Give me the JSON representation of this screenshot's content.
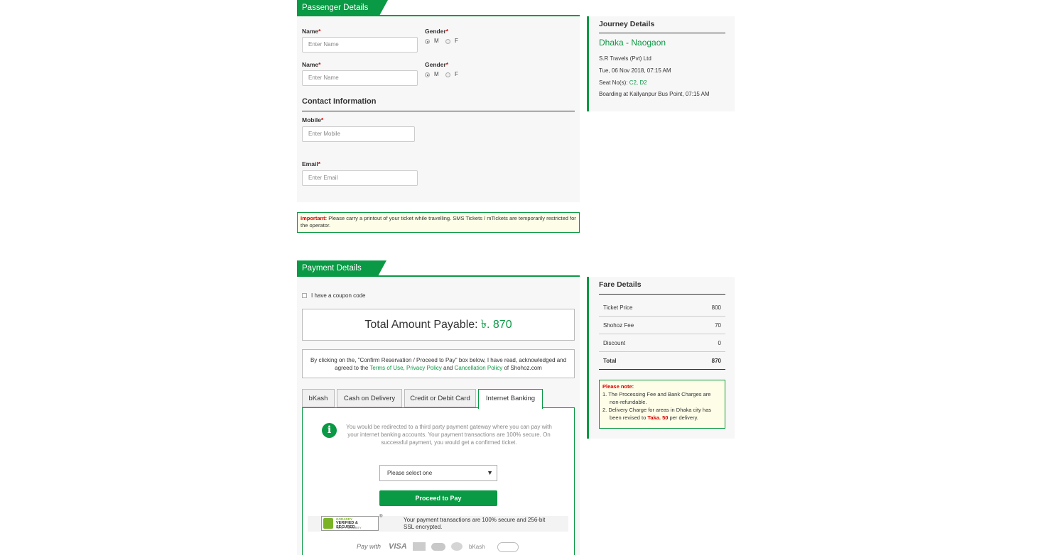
{
  "passenger": {
    "section_title": "Passenger Details",
    "rows": [
      {
        "name_label": "Name",
        "name_placeholder": "Enter Name",
        "gender_label": "Gender",
        "m": "M",
        "f": "F"
      },
      {
        "name_label": "Name",
        "name_placeholder": "Enter Name",
        "gender_label": "Gender",
        "m": "M",
        "f": "F"
      }
    ],
    "required_mark": "*"
  },
  "contact": {
    "title": "Contact Information",
    "mobile_label": "Mobile",
    "mobile_placeholder": "Enter Mobile",
    "email_label": "Email",
    "email_placeholder": "Enter Email"
  },
  "important": {
    "label": "Important:",
    "text": "Please carry a printout of your ticket while travelling. SMS Tickets / mTickets are temporarily restricted for the operator."
  },
  "journey": {
    "title": "Journey Details",
    "route": "Dhaka - Naogaon",
    "operator": "S.R Travels (Pvt) Ltd",
    "datetime": "Tue, 06 Nov 2018, 07:15 AM",
    "seat_label": "Seat No(s):",
    "seats": "C2, D2",
    "boarding": "Boarding at Kallyanpur Bus Point, 07:15 AM"
  },
  "payment": {
    "section_title": "Payment Details",
    "coupon_label": "I have a coupon code",
    "total_label": "Total Amount Payable:",
    "total_value": "৳. 870",
    "terms_line1": "By clicking on the, \"Confirm Reservation / Proceed to Pay\" box below, I have read, acknowledged and",
    "terms_pre": "agreed to the",
    "terms_link1": "Terms of Use",
    "terms_comma": ",",
    "terms_link2": "Privacy Policy",
    "terms_and": "and",
    "terms_link3": "Cancellation Policy",
    "terms_post": "of Shohoz.com",
    "tabs": [
      "bKash",
      "Cash on Delivery",
      "Credit or Debit Card",
      "Internet Banking"
    ],
    "info_text": "You would be redirected to a third party payment gateway where you can pay with your internet banking accounts. Your payment transactions are 100% secure. On successful payment, you would get a confirmed ticket.",
    "select_value": "Please select one",
    "proceed_label": "Proceed to Pay",
    "badge_line1": "GODADDY",
    "badge_line2": "VERIFIED & SECURED",
    "badge_line3": "VERIFY SECURITY",
    "secure_text": "Your payment transactions are 100% secure and 256-bit SSL encrypted.",
    "paywith": "Pay with",
    "logos": [
      "VISA",
      "bKash"
    ]
  },
  "fare": {
    "title": "Fare Details",
    "rows": [
      {
        "label": "Ticket Price",
        "value": "800"
      },
      {
        "label": "Shohoz Fee",
        "value": "70"
      },
      {
        "label": "Discount",
        "value": "0"
      },
      {
        "label": "Total",
        "value": "870"
      }
    ],
    "note_title": "Please note:",
    "note1": "1. The Processing Fee and Bank Charges are non-refundable.",
    "note2_pre": "2. Delivery Charge for areas in Dhaka city has been revised to",
    "note2_amount": "Taka. 50",
    "note2_post": "per delivery."
  },
  "colors": {
    "brand_green": "#0a9944",
    "required_red": "#dd0000",
    "note_bg": "#fdfde8"
  }
}
